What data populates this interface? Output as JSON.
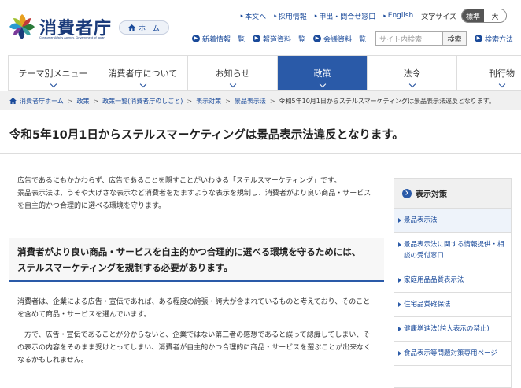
{
  "header": {
    "logo_text": "消費者庁",
    "logo_sub": "Consumer Affairs Agency, Government of Japan",
    "home_label": "ホーム",
    "top_links": [
      "本文へ",
      "採用情報",
      "申出・問合せ窓口",
      "English"
    ],
    "font_size_label": "文字サイズ",
    "font_size_options": [
      "標準",
      "大"
    ],
    "sub_links": [
      "新着情報一覧",
      "報道資料一覧",
      "会議資料一覧"
    ],
    "search_placeholder": "サイト内検索",
    "search_button": "検索",
    "search_method": "検索方法"
  },
  "nav": {
    "items": [
      "テーマ別メニュー",
      "消費者庁について",
      "お知らせ",
      "政策",
      "法令",
      "刊行物"
    ],
    "active": "政策"
  },
  "breadcrumb": {
    "items": [
      "消費者庁ホーム",
      "政策",
      "政策一覧(消費者庁のしごと)",
      "表示対策",
      "景品表示法"
    ],
    "current": "令和5年10月1日からステルスマーケティングは景品表示法違反となります。"
  },
  "page": {
    "title": "令和5年10月1日からステルスマーケティングは景品表示法違反となります。",
    "intro": [
      "広告であるにもかかわらず、広告であることを隠すことがいわゆる「ステルスマーケティング」です。",
      "景品表示法は、うそや大げさな表示など消費者をだますような表示を規制し、消費者がより良い商品・サービス",
      "を自主的かつ合理的に選べる環境を守ります。"
    ],
    "callout": [
      "消費者がより良い商品・サービスを自主的かつ合理的に選べる環境を守るためには、",
      "ステルスマーケティングを規制する必要があります。"
    ],
    "para1": [
      "消費者は、企業による広告・宣伝であれば、ある程度の誇張・誇大が含まれているものと考えており、そのこと",
      "を含めて商品・サービスを選んでいます。"
    ],
    "para2": [
      "一方で、広告・宣伝であることが分からないと、企業ではない第三者の感想であると誤って認識してしまい、そ",
      "の表示の内容をそのまま受けとってしまい、消費者が自主的かつ合理的に商品・サービスを選ぶことが出来なく",
      "なるかもしれません。"
    ]
  },
  "sidebar": {
    "heading": "表示対策",
    "items": [
      "景品表示法",
      "景品表示法に関する情報提供・相談の受付窓口",
      "家庭用品品質表示法",
      "住宅品質確保法",
      "健康増進法(誇大表示の禁止)",
      "食品表示等問題対策専用ページ"
    ]
  }
}
